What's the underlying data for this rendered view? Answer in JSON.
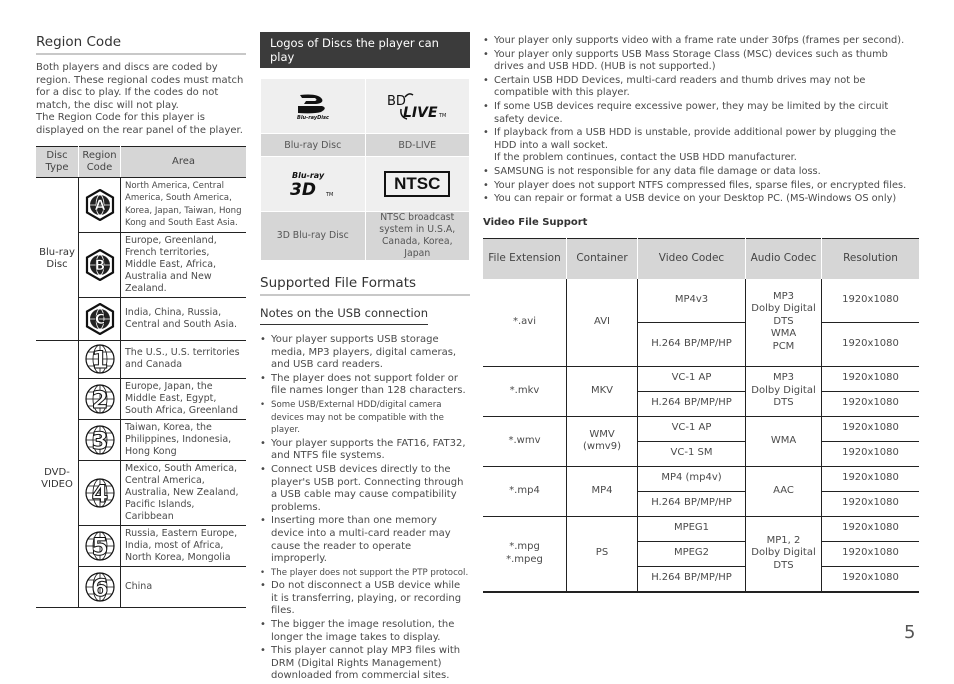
{
  "region_code": {
    "title": "Region Code",
    "intro": "Both players and discs are coded by region. These regional codes must match for a disc to play. If the codes do not match, the disc will not play.\nThe Region Code for this player is displayed on the rear panel of the player.",
    "headers": [
      "Disc Type",
      "Region Code",
      "Area"
    ],
    "groups": [
      {
        "disc_type": "Blu-ray Disc",
        "rows": [
          {
            "code": "A",
            "icon": "region-a-hexagon-icon",
            "area": "North America, Central America, South America, Korea, Japan, Taiwan, Hong Kong and South East Asia."
          },
          {
            "code": "B",
            "icon": "region-b-hexagon-icon",
            "area": "Europe, Greenland, French territories, Middle East, Africa, Australia and New Zealand."
          },
          {
            "code": "C",
            "icon": "region-c-hexagon-icon",
            "area": "India, China, Russia, Central and South Asia."
          }
        ]
      },
      {
        "disc_type": "DVD-VIDEO",
        "rows": [
          {
            "code": "1",
            "icon": "region-1-globe-icon",
            "area": "The U.S., U.S. territories and Canada"
          },
          {
            "code": "2",
            "icon": "region-2-globe-icon",
            "area": "Europe, Japan, the Middle East, Egypt, South Africa, Greenland"
          },
          {
            "code": "3",
            "icon": "region-3-globe-icon",
            "area": "Taiwan, Korea, the Philippines, Indonesia, Hong Kong"
          },
          {
            "code": "4",
            "icon": "region-4-globe-icon",
            "area": "Mexico, South America, Central America, Australia, New Zealand, Pacific Islands, Caribbean"
          },
          {
            "code": "5",
            "icon": "region-5-globe-icon",
            "area": "Russia, Eastern Europe, India, most of Africa, North Korea, Mongolia"
          },
          {
            "code": "6",
            "icon": "region-6-globe-icon",
            "area": "China"
          }
        ]
      }
    ]
  },
  "logos": {
    "title": "Logos of Discs the player can play",
    "items": [
      {
        "logo_text": "Blu-ray Disc",
        "icon": "bluray-disc-logo-icon",
        "caption": "Blu-ray Disc"
      },
      {
        "logo_text": "BD LIVE",
        "icon": "bd-live-logo-icon",
        "caption": "BD-LIVE"
      },
      {
        "logo_text": "Blu-ray 3D",
        "icon": "bluray-3d-logo-icon",
        "caption": "3D Blu-ray Disc"
      },
      {
        "logo_text": "NTSC",
        "icon": "ntsc-logo-icon",
        "caption": "NTSC broadcast system in U.S.A, Canada, Korea, Japan"
      }
    ]
  },
  "supported_formats": {
    "title": "Supported File Formats",
    "usb_notes_title": "Notes on the USB connection",
    "usb_notes": [
      "Your player supports USB storage media, MP3 players, digital cameras, and USB card readers.",
      "The player does not support folder or file names longer than 128 characters.",
      "Some USB/External HDD/digital camera devices may not be compatible with the player.",
      "Your player supports the FAT16, FAT32, and NTFS file systems.",
      "Connect USB devices directly to the player's USB port. Connecting through a USB cable may cause compatibility problems.",
      "Inserting more than one memory device into a multi-card reader may cause the reader to operate improperly.",
      "The player does not support the PTP protocol.",
      "Do not disconnect a USB device while it is transferring, playing, or recording files.",
      "The bigger the image resolution, the longer the image takes to display.",
      "This player cannot play MP3 files with DRM (Digital Rights Management) downloaded from commercial sites."
    ],
    "usb_notes_cont": [
      "Your player only supports video with a frame rate under 30fps (frames per second).",
      "Your player only supports USB Mass Storage Class (MSC) devices such as thumb drives and USB HDD. (HUB is not supported.)",
      "Certain USB HDD Devices, multi-card readers and thumb drives may not be compatible with this player.",
      "If some USB devices require excessive power, they may be limited by the circuit safety device.",
      "If playback from a USB HDD is unstable, provide additional power by plugging the HDD into a wall socket.\nIf the problem continues, contact the USB HDD manufacturer.",
      "SAMSUNG is not responsible for any data file damage or data loss.",
      "Your player does not support NTFS compressed files, sparse files, or encrypted files.",
      "You can repair or format a USB device on your Desktop PC. (MS-Windows OS only)"
    ]
  },
  "video_file_support": {
    "title": "Video File Support",
    "headers": [
      "File Extension",
      "Container",
      "Video Codec",
      "Audio Codec",
      "Resolution"
    ],
    "groups": [
      {
        "extension": "*.avi",
        "container": "AVI",
        "audio": "MP3\nDolby Digital\nDTS\nWMA\nPCM",
        "rows": [
          {
            "video": "MP4v3",
            "resolution": "1920x1080"
          },
          {
            "video": "H.264 BP/MP/HP",
            "resolution": "1920x1080"
          }
        ]
      },
      {
        "extension": "*.mkv",
        "container": "MKV",
        "audio": "MP3\nDolby Digital\nDTS",
        "rows": [
          {
            "video": "VC-1 AP",
            "resolution": "1920x1080"
          },
          {
            "video": "H.264 BP/MP/HP",
            "resolution": "1920x1080"
          }
        ]
      },
      {
        "extension": "*.wmv",
        "container": "WMV\n(wmv9)",
        "audio": "WMA",
        "rows": [
          {
            "video": "VC-1 AP",
            "resolution": "1920x1080"
          },
          {
            "video": "VC-1 SM",
            "resolution": "1920x1080"
          }
        ]
      },
      {
        "extension": "*.mp4",
        "container": "MP4",
        "audio": "AAC",
        "rows": [
          {
            "video": "MP4 (mp4v)",
            "resolution": "1920x1080"
          },
          {
            "video": "H.264 BP/MP/HP",
            "resolution": "1920x1080"
          }
        ]
      },
      {
        "extension": "*.mpg\n*.mpeg",
        "container": "PS",
        "audio": "MP1, 2\nDolby Digital\nDTS",
        "rows": [
          {
            "video": "MPEG1",
            "resolution": "1920x1080"
          },
          {
            "video": "MPEG2",
            "resolution": "1920x1080"
          },
          {
            "video": "H.264 BP/MP/HP",
            "resolution": "1920x1080"
          }
        ]
      }
    ]
  },
  "page_number": "5"
}
